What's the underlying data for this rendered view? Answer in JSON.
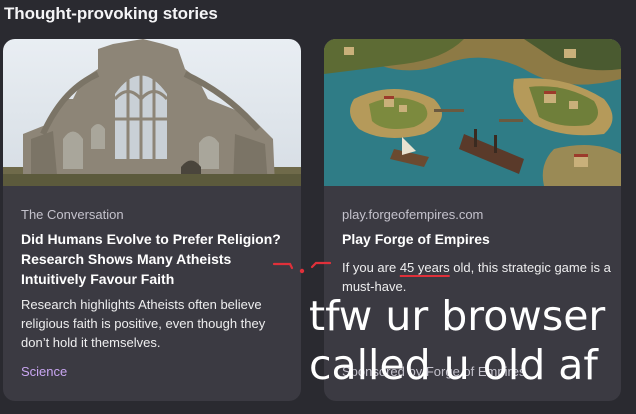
{
  "section": {
    "title": "Thought-provoking stories"
  },
  "cards": [
    {
      "source": "The Conversation",
      "title": "Did Humans Evolve to Prefer Religion? Research Shows Many Atheists Intuitively Favour Faith",
      "description": "Research highlights Atheists often believe religious faith is positive, even though they don’t hold it themselves.",
      "tag": "Science",
      "image_icon": "abbey-ruins-photo"
    },
    {
      "source": "play.forgeofempires.com",
      "title": "Play Forge of Empires",
      "description_pre": "If you are ",
      "description_highlight": "45 years",
      "description_post": " old, this strategic game is a must-have.",
      "sponsored": "Sponsored by Forge of Empires",
      "image_icon": "game-island-scene"
    }
  ],
  "overlay": {
    "line1": "tfw ur browser",
    "line2": "called u old af"
  },
  "colors": {
    "background": "#2a2a30",
    "card": "#3b3a42",
    "tag": "#c9a6f2",
    "annotation": "#e0303a"
  }
}
